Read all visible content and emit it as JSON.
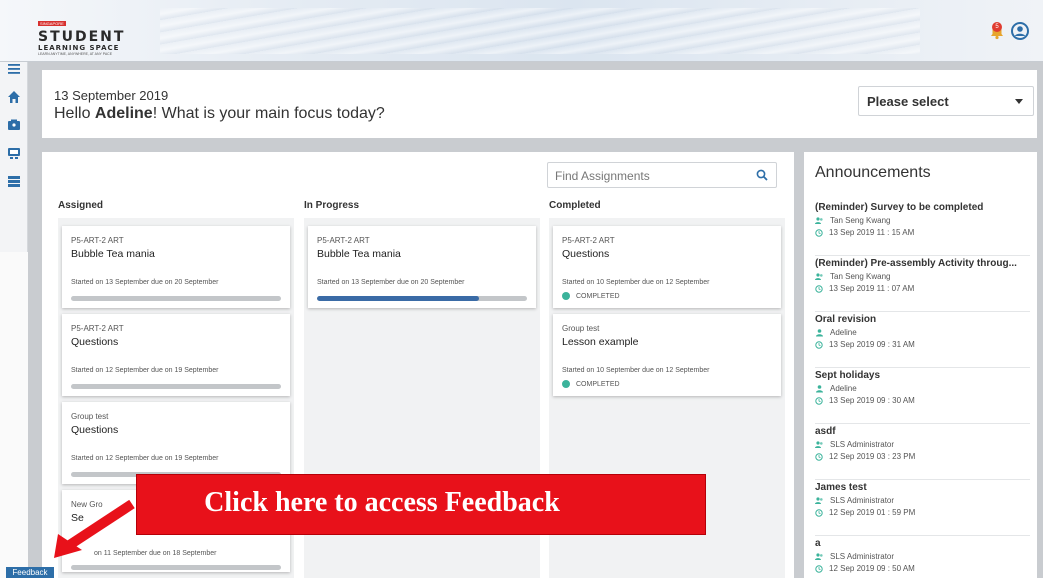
{
  "header": {
    "logo_badge": "SINGAPORE",
    "logo_main": "STUDENT",
    "logo_sub": "LEARNING SPACE",
    "logo_tag": "LEARN ANYTIME, ANYWHERE, AT ANY PACE",
    "notification_count": "5"
  },
  "greeting": {
    "date": "13 September 2019",
    "hello_prefix": "Hello ",
    "name": "Adeline",
    "hello_suffix": "! What is your main focus today?",
    "focus_select_value": "Please select"
  },
  "board": {
    "search_placeholder": "Find Assignments",
    "columns": [
      {
        "title": "Assigned",
        "cards": [
          {
            "code": "P5-ART-2 ART",
            "title": "Bubble Tea mania",
            "dates": "Started on 13 September due on 20 September",
            "progress": 0
          },
          {
            "code": "P5-ART-2 ART",
            "title": "Questions",
            "dates": "Started on 12 September due on 19 September",
            "progress": 0
          },
          {
            "code": "Group test",
            "title": "Questions",
            "dates": "Started on 12 September due on 19 September",
            "progress": 0
          },
          {
            "code": "New Gro",
            "title": "Se",
            "dates": "on 11 September due on 18 September",
            "progress": 0
          }
        ]
      },
      {
        "title": "In Progress",
        "cards": [
          {
            "code": "P5-ART-2 ART",
            "title": "Bubble Tea mania",
            "dates": "Started on 13 September due on 20 September",
            "progress": 0.77
          }
        ]
      },
      {
        "title": "Completed",
        "cards": [
          {
            "code": "P5-ART-2 ART",
            "title": "Questions",
            "dates": "Started on 10 September due on 12 September",
            "status": "COMPLETED"
          },
          {
            "code": "Group test",
            "title": "Lesson example",
            "dates": "Started on 10 September due on 12 September",
            "status": "COMPLETED"
          }
        ]
      }
    ]
  },
  "announcements": {
    "title": "Announcements",
    "items": [
      {
        "title": "(Reminder) Survey to be completed",
        "author": "Tan Seng Kwang",
        "date": "13 Sep 2019 11 : 15 AM"
      },
      {
        "title": "(Reminder) Pre-assembly Activity throug...",
        "author": "Tan Seng Kwang",
        "date": "13 Sep 2019 11 : 07 AM"
      },
      {
        "title": "Oral revision",
        "author": "Adeline",
        "date": "13 Sep 2019 09 : 31 AM"
      },
      {
        "title": "Sept holidays",
        "author": "Adeline",
        "date": "13 Sep 2019 09 : 30 AM"
      },
      {
        "title": "asdf",
        "author": "SLS Administrator",
        "date": "12 Sep 2019 03 : 23 PM"
      },
      {
        "title": "James test",
        "author": "SLS Administrator",
        "date": "12 Sep 2019 01 : 59 PM"
      },
      {
        "title": "a",
        "author": "SLS Administrator",
        "date": "12 Sep 2019 09 : 50 AM"
      }
    ]
  },
  "overlay": {
    "callout_text": "Click here to access Feedback",
    "feedback_tab": "Feedback"
  },
  "colors": {
    "accent_blue": "#2d6ea8",
    "progress_blue": "#3a6ba6",
    "completed_green": "#3bb39b",
    "callout_red": "#e8111a"
  }
}
